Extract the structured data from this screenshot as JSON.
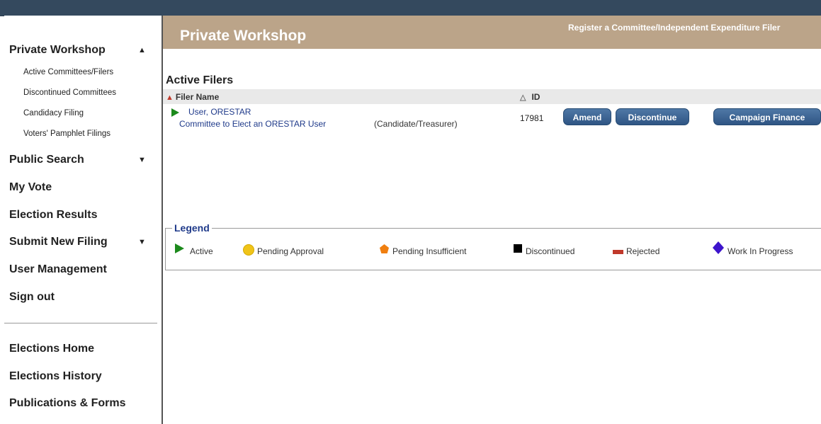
{
  "sidebar": {
    "private_workshop": "Private Workshop",
    "sub_items": [
      "Active Committees/Filers",
      "Discontinued Committees",
      "Candidacy Filing",
      "Voters' Pamphlet Filings"
    ],
    "public_search": "Public Search",
    "my_vote": "My Vote",
    "election_results": "Election Results",
    "submit_new_filing": "Submit New Filing",
    "user_management": "User Management",
    "sign_out": "Sign out",
    "elections_home": "Elections Home",
    "elections_history": "Elections History",
    "publications_forms": "Publications & Forms",
    "arrow_up": "▲",
    "arrow_down": "▼"
  },
  "header": {
    "title": "Private Workshop",
    "register_link": "Register a Committee/Independent Expenditure Filer"
  },
  "main": {
    "section_title": "Active Filers",
    "columns": {
      "filer_name": "Filer Name",
      "id": "ID"
    },
    "rows": [
      {
        "filer": "User, ORESTAR",
        "committee": "Committee to Elect an ORESTAR User",
        "role": "(Candidate/Treasurer)",
        "id": "17981",
        "status": "active"
      }
    ],
    "buttons": {
      "amend": "Amend",
      "discontinue": "Discontinue",
      "campaign_finance": "Campaign Finance"
    }
  },
  "legend": {
    "title": "Legend",
    "items": [
      "Active",
      "Pending Approval",
      "Pending Insufficient",
      "Discontinued",
      "Rejected",
      "Work In Progress"
    ]
  },
  "colors": {
    "header_bg": "#bba489",
    "button_bg": "#3a6393",
    "active": "#1c8a1c",
    "pending_approval": "#f0c419",
    "pending_insufficient": "#f07f10",
    "discontinued": "#000000",
    "rejected": "#c0392b",
    "work_in_progress": "#3d14cc"
  }
}
